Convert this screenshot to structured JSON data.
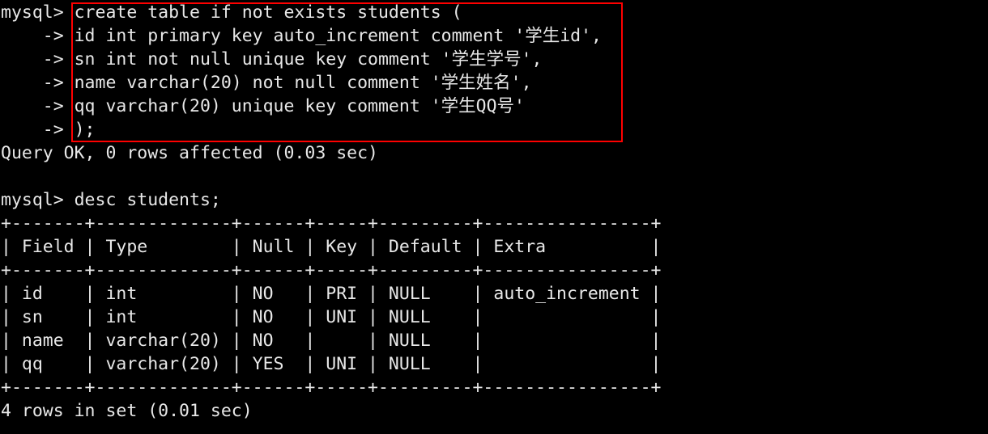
{
  "terminal": {
    "background_color": "#000000",
    "text_color": "#e8e8e8",
    "annotation_color": "#fe0000",
    "prompt": "mysql>",
    "continuation_prompt": "->",
    "lines": [
      "mysql> create table if not exists students (",
      "    -> id int primary key auto_increment comment '学生id',",
      "    -> sn int not null unique key comment '学生学号',",
      "    -> name varchar(20) not null comment '学生姓名',",
      "    -> qq varchar(20) unique key comment '学生QQ号'",
      "    -> );",
      "Query OK, 0 rows affected (0.03 sec)",
      "",
      "mysql> desc students;",
      "+-------+-------------+------+-----+---------+----------------+",
      "| Field | Type        | Null | Key | Default | Extra          |",
      "+-------+-------------+------+-----+---------+----------------+",
      "| id    | int         | NO   | PRI | NULL    | auto_increment |",
      "| sn    | int         | NO   | UNI | NULL    |                |",
      "| name  | varchar(20) | NO   |     | NULL    |                |",
      "| qq    | varchar(20) | YES  | UNI | NULL    |                |",
      "+-------+-------------+------+-----+---------+----------------+",
      "4 rows in set (0.01 sec)"
    ],
    "create_statement": {
      "line_1": "create table if not exists students (",
      "line_2": "id int primary key auto_increment comment '学生id',",
      "line_3": "sn int not null unique key comment '学生学号',",
      "line_4": "name varchar(20) not null comment '学生姓名',",
      "line_5": "qq varchar(20) unique key comment '学生QQ号'",
      "line_6": ");"
    },
    "create_result": "Query OK, 0 rows affected (0.03 sec)",
    "desc_command": "desc students;",
    "desc_result": {
      "columns": [
        "Field",
        "Type",
        "Null",
        "Key",
        "Default",
        "Extra"
      ],
      "rows": [
        [
          "id",
          "int",
          "NO",
          "PRI",
          "NULL",
          "auto_increment"
        ],
        [
          "sn",
          "int",
          "NO",
          "UNI",
          "NULL",
          ""
        ],
        [
          "name",
          "varchar(20)",
          "NO",
          "",
          "NULL",
          ""
        ],
        [
          "qq",
          "varchar(20)",
          "YES",
          "UNI",
          "NULL",
          ""
        ]
      ],
      "footer": "4 rows in set (0.01 sec)"
    }
  }
}
